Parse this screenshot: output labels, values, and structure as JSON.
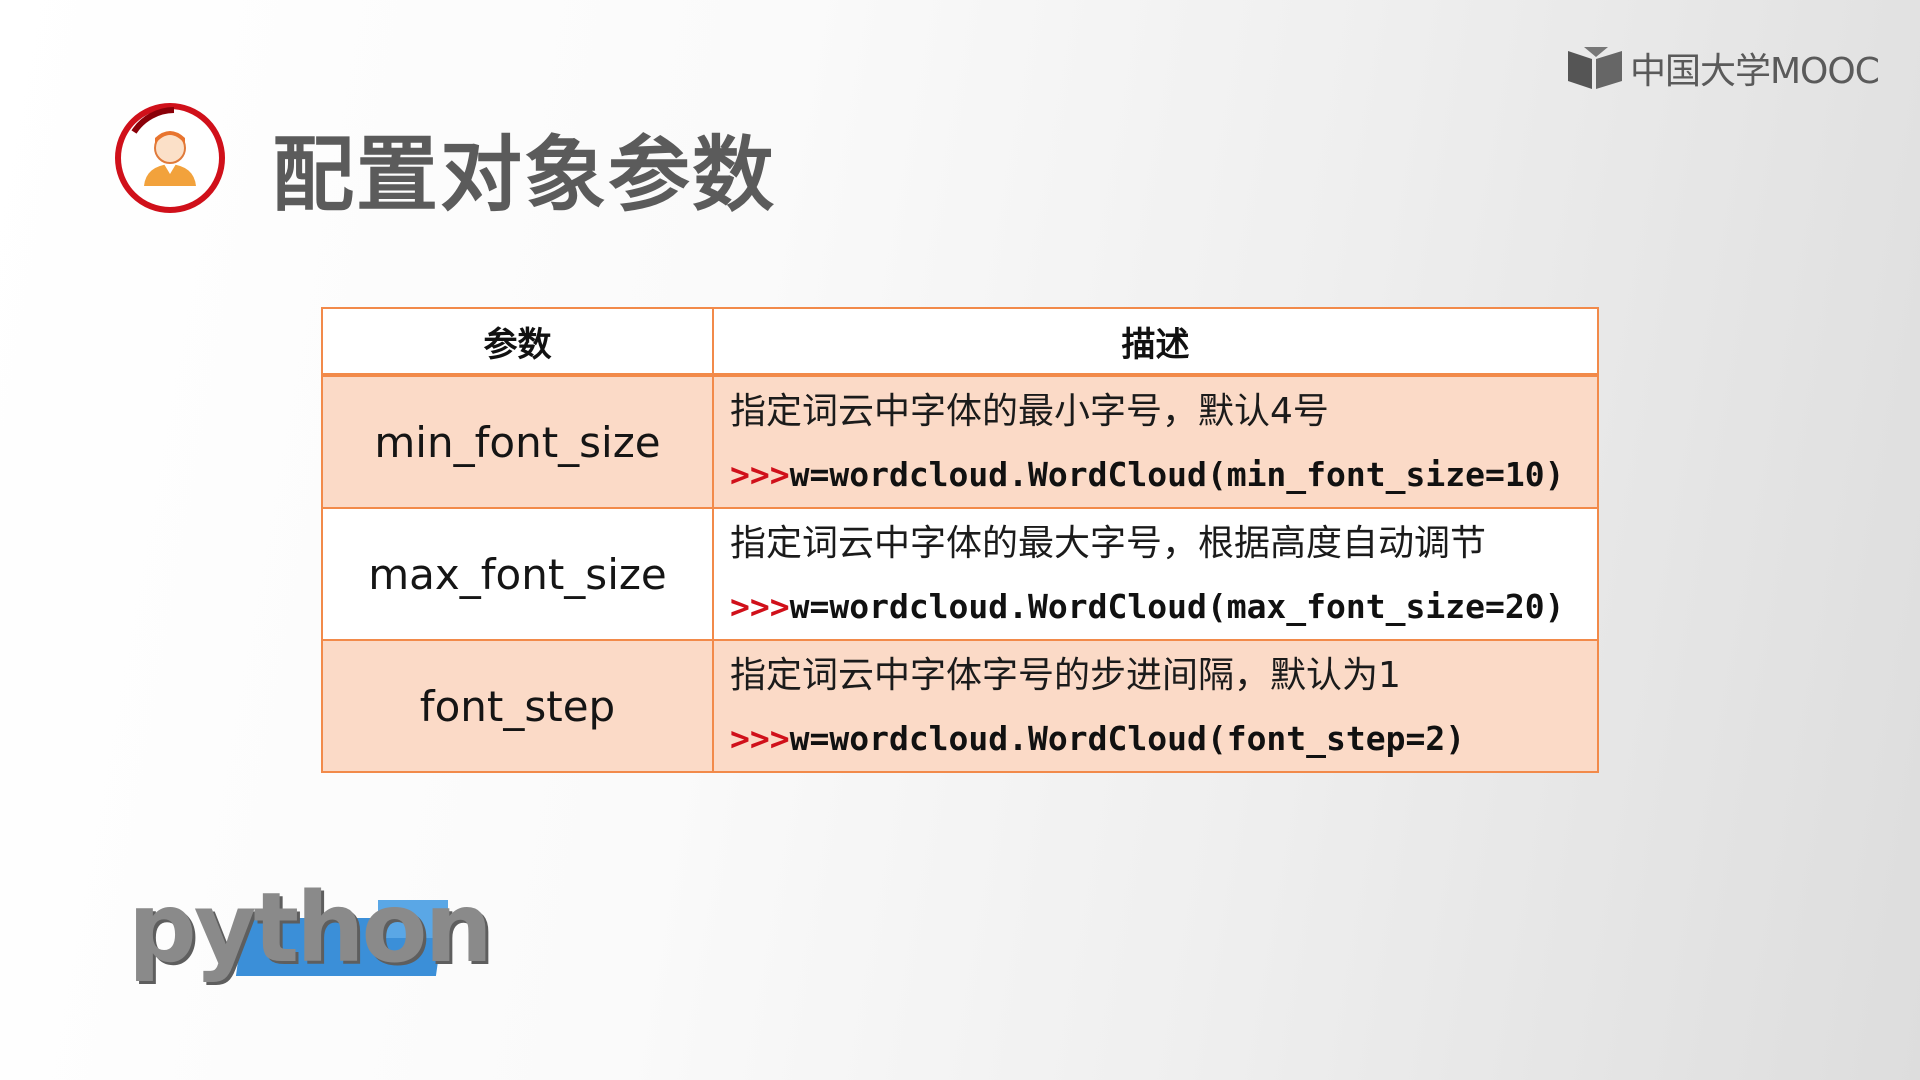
{
  "brand": {
    "logo_text": "中国大学MOOC"
  },
  "slide": {
    "title": "配置对象参数"
  },
  "table": {
    "headers": [
      "参数",
      "描述"
    ],
    "rows": [
      {
        "param": "min_font_size",
        "desc": "指定词云中字体的最小字号，默认4号",
        "prompt": ">>>",
        "code": "w=wordcloud.WordCloud(min_font_size=10)"
      },
      {
        "param": "max_font_size",
        "desc": "指定词云中字体的最大字号，根据高度自动调节",
        "prompt": ">>>",
        "code": "w=wordcloud.WordCloud(max_font_size=20)"
      },
      {
        "param": "font_step",
        "desc": "指定词云中字体字号的步进间隔，默认为1",
        "prompt": ">>>",
        "code": "w=wordcloud.WordCloud(font_step=2)"
      }
    ]
  },
  "footer_logo": {
    "text": "python"
  },
  "colors": {
    "accent": "#f28a4a",
    "prompt": "#d0101a",
    "row_fill": "#fbdac7",
    "icon_ring": "#d0101a"
  }
}
